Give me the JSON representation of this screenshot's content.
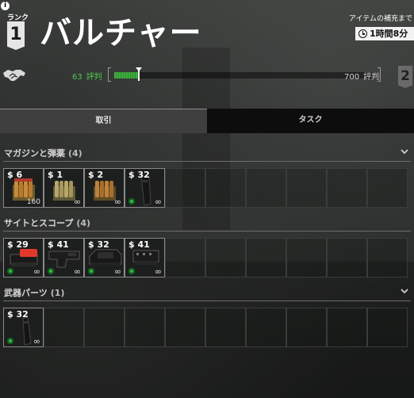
{
  "header": {
    "info_glyph": "i",
    "rank_label": "ランク",
    "rank": "1",
    "trader_name": "バルチャー",
    "restock_label": "アイテムの補充まで",
    "restock_time": "1時間8分"
  },
  "reputation": {
    "current_value": "63",
    "current_label": "評判",
    "max_value": "700",
    "max_label": "評判",
    "progress_fraction": 0.09,
    "next_rank": "2",
    "bar_color": "#3fae3f"
  },
  "tabs": [
    {
      "label": "取引",
      "active": true
    },
    {
      "label": "タスク",
      "active": false
    }
  ],
  "sections": [
    {
      "title": "マガジンと弾薬",
      "count": "(4)",
      "items": [
        {
          "price": "$ 6",
          "qty": "160",
          "infinite": "",
          "kind": "ammo-box-icon"
        },
        {
          "price": "$ 1",
          "qty": "",
          "infinite": "∞",
          "kind": "ammo-box-icon"
        },
        {
          "price": "$ 2",
          "qty": "",
          "infinite": "∞",
          "kind": "ammo-box-icon"
        },
        {
          "price": "$ 32",
          "qty": "",
          "infinite": "∞",
          "kind": "magazine-icon"
        }
      ]
    },
    {
      "title": "サイトとスコープ",
      "count": "(4)",
      "items": [
        {
          "price": "$ 29",
          "qty": "",
          "infinite": "∞",
          "kind": "red-dot-sight-icon"
        },
        {
          "price": "$ 41",
          "qty": "",
          "infinite": "∞",
          "kind": "scope-mount-icon"
        },
        {
          "price": "$ 32",
          "qty": "",
          "infinite": "∞",
          "kind": "holo-sight-icon"
        },
        {
          "price": "$ 41",
          "qty": "",
          "infinite": "∞",
          "kind": "rail-mount-icon"
        }
      ]
    },
    {
      "title": "武器パーツ",
      "count": "(1)",
      "items": [
        {
          "price": "$ 32",
          "qty": "",
          "infinite": "∞",
          "kind": "weapon-part-icon"
        }
      ]
    }
  ]
}
